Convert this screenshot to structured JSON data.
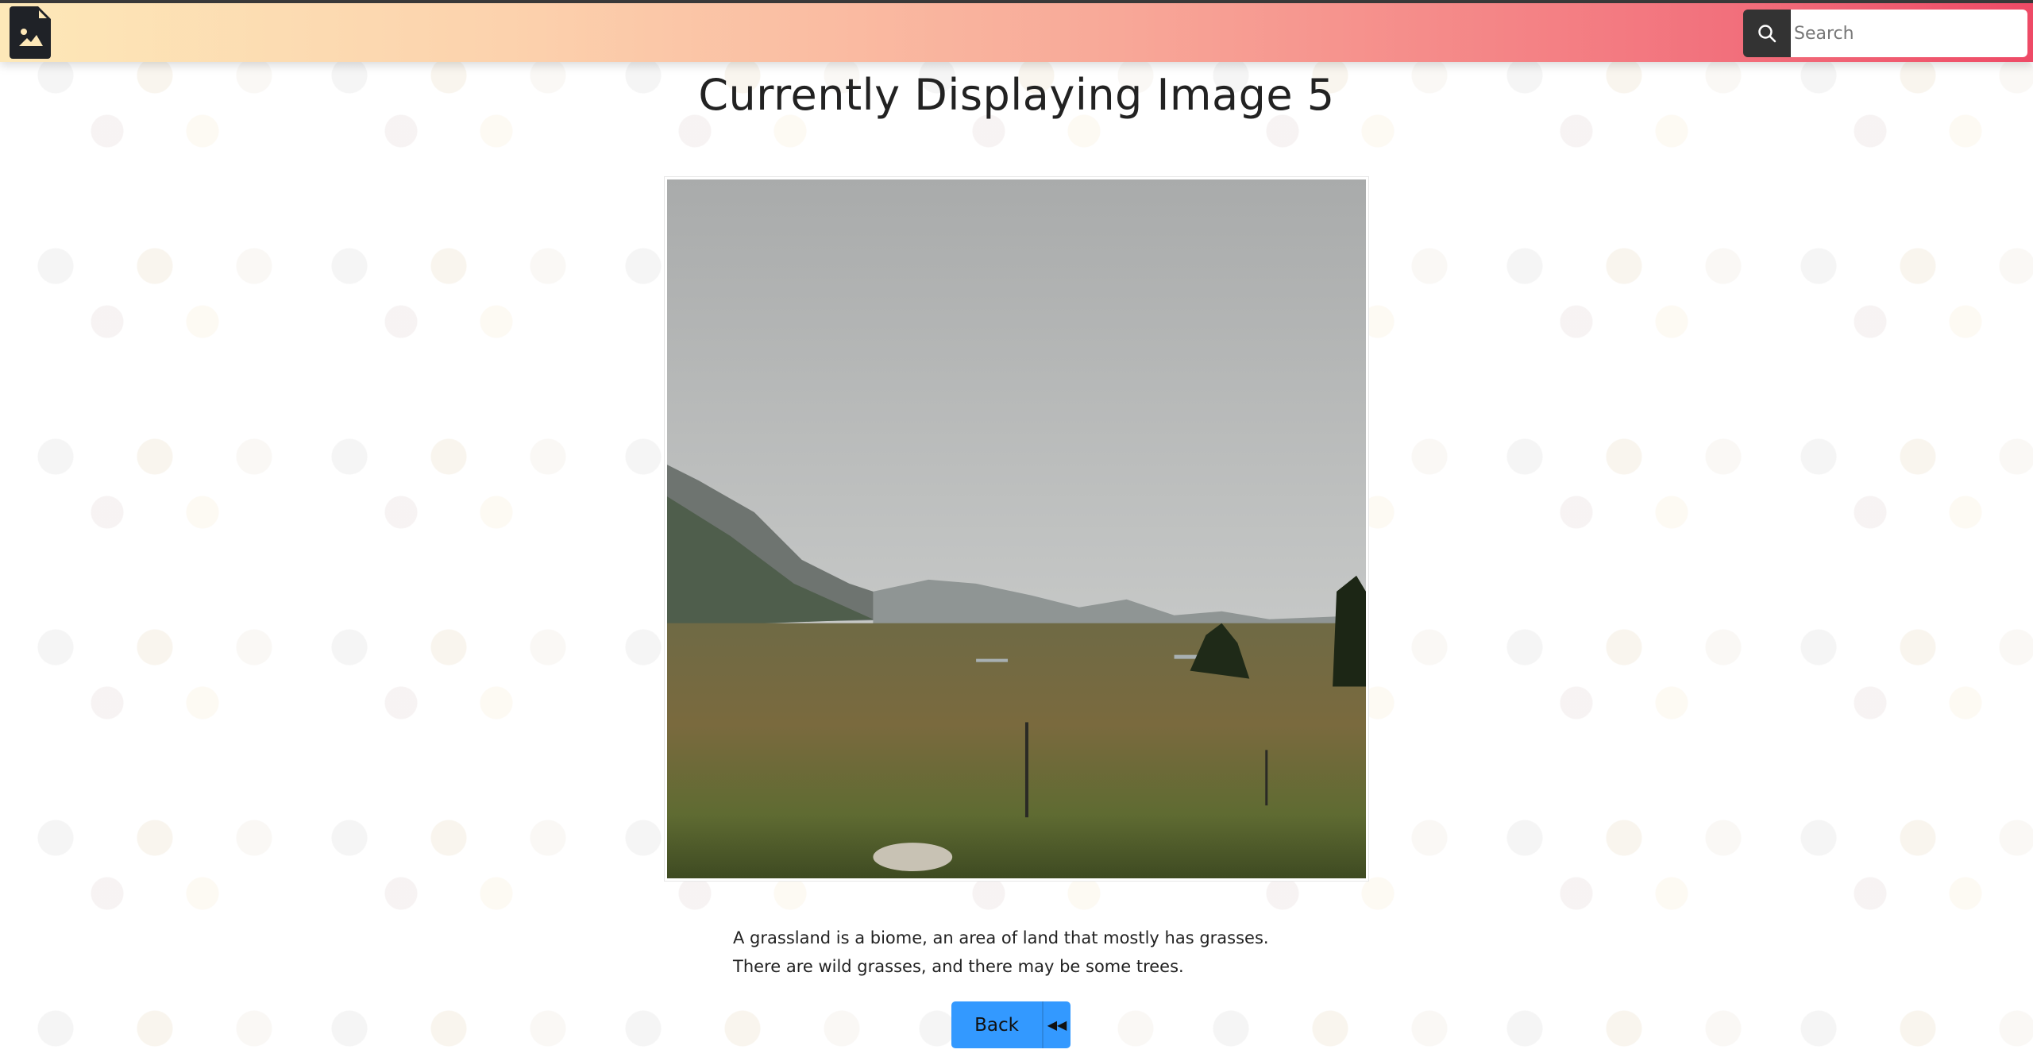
{
  "header": {
    "logo_icon": "file-image-icon",
    "search_icon": "search-icon",
    "search_placeholder": "Search",
    "search_value": ""
  },
  "page": {
    "title": "Currently Displaying Image 5"
  },
  "image": {
    "subject": "grassland-landscape"
  },
  "description": {
    "line1": "A grassland is a biome, an area of land that mostly has grasses.",
    "line2": "There are wild grasses, and there may be some trees."
  },
  "back_button": {
    "label": "Back",
    "icon": "backward-icon",
    "color": "#3399ff"
  }
}
